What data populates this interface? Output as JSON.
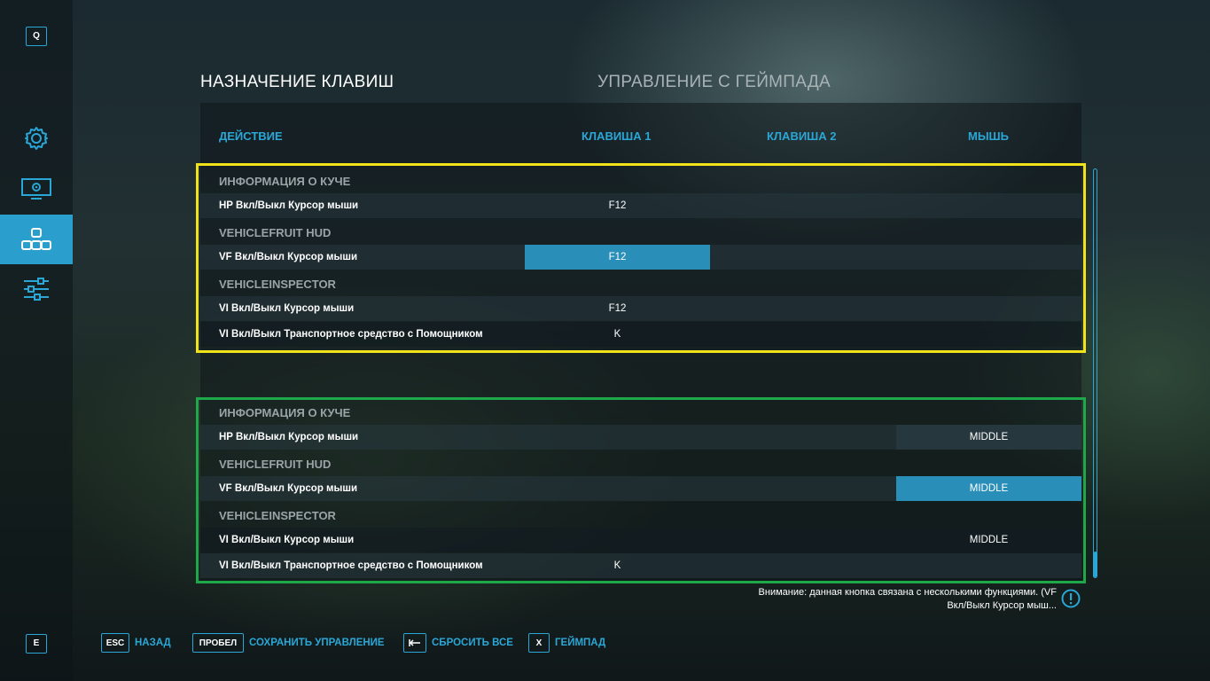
{
  "sidebar": {
    "top_key": "Q",
    "bottom_key": "E",
    "items": [
      {
        "icon": "gear-icon",
        "active": false
      },
      {
        "icon": "display-settings-icon",
        "active": false
      },
      {
        "icon": "keybindings-icon",
        "active": true
      },
      {
        "icon": "sliders-icon",
        "active": false
      }
    ]
  },
  "tabs": {
    "active": "НАЗНАЧЕНИЕ КЛАВИШ",
    "inactive": "УПРАВЛЕНИЕ С ГЕЙМПАДА"
  },
  "columns": {
    "action": "ДЕЙСТВИЕ",
    "key1": "КЛАВИША 1",
    "key2": "КЛАВИША 2",
    "mouse": "МЫШЬ"
  },
  "group1": {
    "sec1": "ИНФОРМАЦИЯ О КУЧЕ",
    "r1_label": "HP Вкл/Выкл Курсор мыши",
    "r1_key1": "F12",
    "sec2": "VEHICLEFRUIT HUD",
    "r2_label": "VF Вкл/Выкл Курсор мыши",
    "r2_key1": "F12",
    "sec3": "VEHICLEINSPECTOR",
    "r3_label": "VI Вкл/Выкл Курсор мыши",
    "r3_key1": "F12",
    "r4_label": "VI Вкл/Выкл Транспортное средство с Помощником",
    "r4_key1": "K"
  },
  "group2": {
    "sec1": "ИНФОРМАЦИЯ О КУЧЕ",
    "r1_label": "HP Вкл/Выкл Курсор мыши",
    "r1_mouse": "MIDDLE",
    "sec2": "VEHICLEFRUIT HUD",
    "r2_label": "VF Вкл/Выкл Курсор мыши",
    "r2_mouse": "MIDDLE",
    "sec3": "VEHICLEINSPECTOR",
    "r3_label": "VI Вкл/Выкл Курсор мыши",
    "r3_mouse": "MIDDLE",
    "r4_label": "VI Вкл/Выкл Транспортное средство с Помощником",
    "r4_key1": "K"
  },
  "warning": {
    "line1": "Внимание: данная кнопка связана с несколькими функциями. (VF",
    "line2": "Вкл/Выкл Курсор мыш..."
  },
  "footer": {
    "back_key": "ESC",
    "back_label": "НАЗАД",
    "save_key": "ПРОБЕЛ",
    "save_label": "СОХРАНИТЬ УПРАВЛЕНИЕ",
    "reset_label": "СБРОСИТЬ ВСЕ",
    "gamepad_key": "X",
    "gamepad_label": "ГЕЙМПАД"
  },
  "colors": {
    "accent": "#2aa7d6",
    "highlight_yellow": "#f2e21a",
    "highlight_green": "#1fa84a",
    "selected_cell": "#2a8fb8"
  }
}
